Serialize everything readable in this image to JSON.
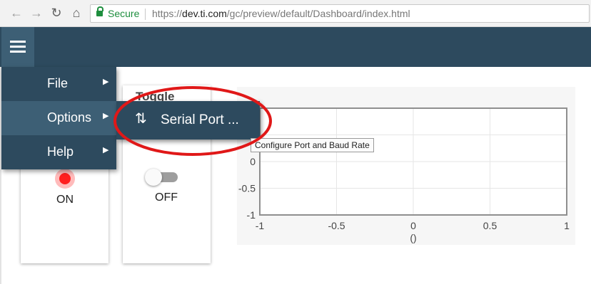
{
  "browser": {
    "secure_label": "Secure",
    "url_prefix": "https://",
    "url_host": "dev.ti.com",
    "url_path": "/gc/preview/default/Dashboard/index.html"
  },
  "menu": {
    "items": [
      {
        "label": "File"
      },
      {
        "label": "Options"
      },
      {
        "label": "Help"
      }
    ],
    "submenu": {
      "label": "Serial Port ..."
    },
    "tooltip": "Configure Port and Baud Rate"
  },
  "cards": {
    "led": {
      "state_label": "ON"
    },
    "toggle": {
      "title": "Toggle",
      "state_label": "OFF",
      "checked": false
    }
  },
  "chart_data": {
    "type": "line",
    "series": [],
    "xlim": [
      -1,
      1
    ],
    "ylim": [
      -1,
      1
    ],
    "xticks": [
      "-1",
      "-0.5",
      "0",
      "0.5",
      "1"
    ],
    "yticks": [
      "-1",
      "-0.5",
      "0"
    ],
    "xlabel": "()",
    "grid": true
  },
  "colors": {
    "appbar": "#2d4a5e",
    "accent": "#3d5f75",
    "led_on": "#ff1f1f",
    "highlight": "#e01818"
  }
}
